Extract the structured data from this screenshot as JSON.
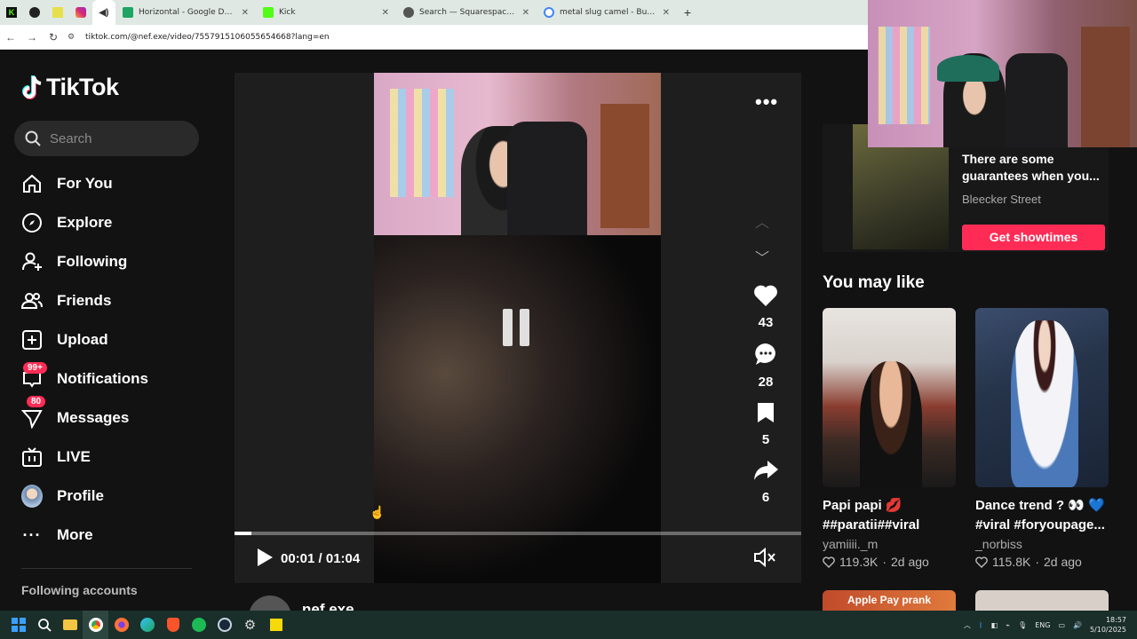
{
  "browser": {
    "tabs": [
      {
        "title": "Horizontal - Google Drive",
        "favicon_color": "#1fa463"
      },
      {
        "title": "Kick",
        "favicon_color": "#53fc18"
      },
      {
        "title": "Search — Squarespace Domain",
        "favicon_color": "#555555"
      },
      {
        "title": "metal slug camel - Buscar con G",
        "favicon_color": "#4285f4"
      }
    ],
    "url": "tiktok.com/@nef.exe/video/7557915106055654668?lang=en"
  },
  "sidebar": {
    "logo": "TikTok",
    "search_placeholder": "Search",
    "items": [
      {
        "label": "For You",
        "icon": "home-icon"
      },
      {
        "label": "Explore",
        "icon": "compass-icon"
      },
      {
        "label": "Following",
        "icon": "user-plus-icon"
      },
      {
        "label": "Friends",
        "icon": "friends-icon"
      },
      {
        "label": "Upload",
        "icon": "upload-icon"
      },
      {
        "label": "Notifications",
        "icon": "inbox-icon",
        "badge": "99+"
      },
      {
        "label": "Messages",
        "icon": "send-icon",
        "badge": "80"
      },
      {
        "label": "LIVE",
        "icon": "live-icon"
      },
      {
        "label": "Profile",
        "icon": "avatar-icon"
      },
      {
        "label": "More",
        "icon": "more-icon"
      }
    ],
    "following_title": "Following accounts"
  },
  "video": {
    "likes": "43",
    "comments": "28",
    "saves": "5",
    "shares": "6",
    "time": "00:01 / 01:04",
    "progress": 0.03,
    "author": "nef.exe"
  },
  "ad": {
    "title": "There are some guarantees when you...",
    "sponsor": "Bleecker Street",
    "cta": "Get showtimes"
  },
  "you_may_like": {
    "title": "You may like",
    "cards": [
      {
        "caption": "Papi papi 💋 ##paratii##viral",
        "user": "yamiiii._m",
        "likes": "119.3K",
        "age": "2d ago"
      },
      {
        "caption": "Dance trend ? 👀 💙 #viral #foryoupage...",
        "user": "_norbiss",
        "likes": "115.8K",
        "age": "2d ago"
      }
    ],
    "next_label": "Apple Pay prank"
  },
  "taskbar": {
    "lang": "ENG",
    "time": "18:57",
    "date": "5/10/2025"
  },
  "colors": {
    "brand": "#fe2c55",
    "bg": "#121212"
  }
}
